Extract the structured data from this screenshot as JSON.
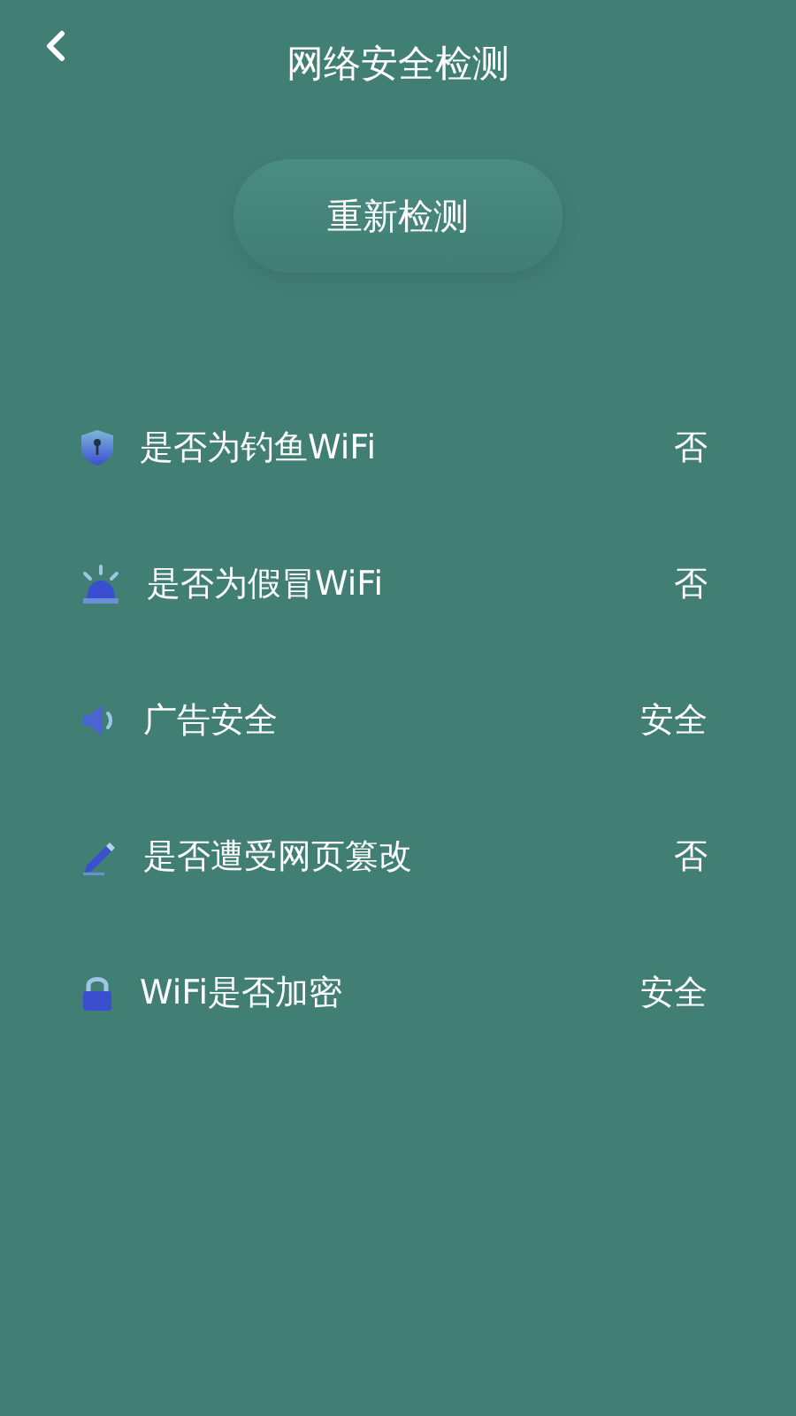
{
  "header": {
    "title": "网络安全检测"
  },
  "rescan_button": {
    "label": "重新检测"
  },
  "checks": [
    {
      "kind": "shield",
      "label": "是否为钓鱼WiFi",
      "result": "否"
    },
    {
      "kind": "alarm",
      "label": "是否为假冒WiFi",
      "result": "否"
    },
    {
      "kind": "speaker",
      "label": "广告安全",
      "result": "安全"
    },
    {
      "kind": "pencil",
      "label": "是否遭受网页篡改",
      "result": "否"
    },
    {
      "kind": "lock",
      "label": "WiFi是否加密",
      "result": "安全"
    }
  ]
}
